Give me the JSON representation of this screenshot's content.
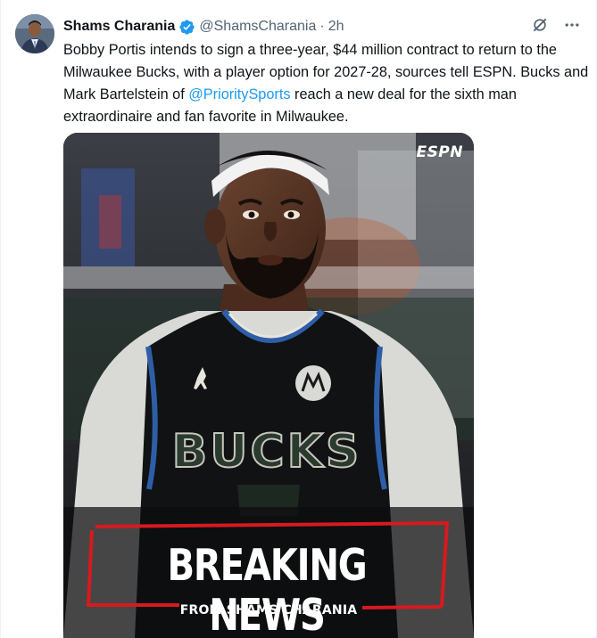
{
  "tweet": {
    "author_name": "Shams Charania",
    "handle": "@ShamsCharania",
    "separator": "·",
    "time": "2h",
    "text_before_mention": "Bobby Portis intends to sign a three-year, $44 million contract to return to the Milwaukee Bucks, with a player option for 2027-28, sources tell ESPN. Bucks and Mark Bartelstein of ",
    "mention": "@PrioritySports",
    "text_after_mention": " reach a new deal for the sixth man extraordinaire and fan favorite in Milwaukee."
  },
  "icons": {
    "verified": "verified-badge-icon",
    "grok": "grok-icon",
    "more": "more-icon"
  },
  "media": {
    "logo": "ESPN",
    "jersey_text": "BUCKS",
    "headline": "BREAKING NEWS",
    "subline": "FROM SHAMS CHARANIA"
  },
  "colors": {
    "accent": "#1d9bf0",
    "secondary_text": "#536471",
    "breaking_red": "#d71920",
    "bucks_green": "#00471b"
  }
}
